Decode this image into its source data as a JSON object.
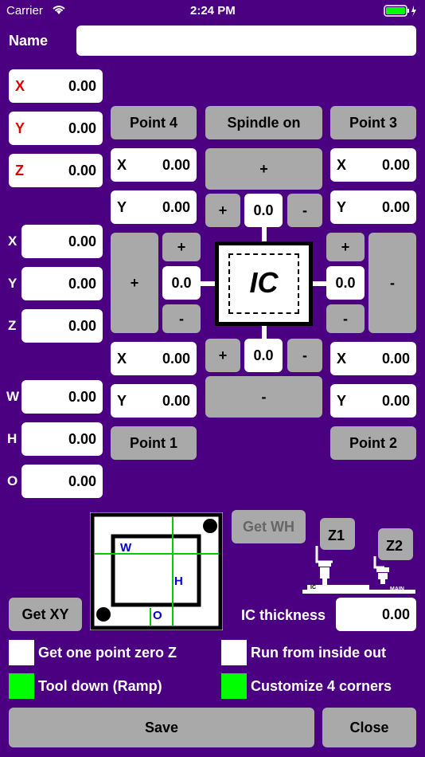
{
  "status": {
    "carrier": "Carrier",
    "time": "2:24 PM"
  },
  "name": {
    "label": "Name",
    "value": ""
  },
  "machine": [
    {
      "axis": "X",
      "value": "0.00"
    },
    {
      "axis": "Y",
      "value": "0.00"
    },
    {
      "axis": "Z",
      "value": "0.00"
    }
  ],
  "offset": [
    {
      "axis": "X",
      "value": "0.00"
    },
    {
      "axis": "Y",
      "value": "0.00"
    },
    {
      "axis": "Z",
      "value": "0.00"
    }
  ],
  "size": [
    {
      "axis": "W",
      "value": "0.00"
    },
    {
      "axis": "H",
      "value": "0.00"
    },
    {
      "axis": "O",
      "value": "0.00"
    }
  ],
  "points": {
    "p4": {
      "label": "Point 4",
      "x": "0.00",
      "y": "0.00"
    },
    "p3": {
      "label": "Point 3",
      "x": "0.00",
      "y": "0.00"
    },
    "p1": {
      "label": "Point 1",
      "x": "0.00",
      "y": "0.00"
    },
    "p2": {
      "label": "Point 2",
      "x": "0.00",
      "y": "0.00"
    },
    "x_label": "X",
    "y_label": "Y"
  },
  "spindle": "Spindle on",
  "jog": {
    "plus": "+",
    "minus": "-",
    "top": "0.0",
    "left": "0.0",
    "right": "0.0",
    "bottom": "0.0"
  },
  "ic_label": "IC",
  "diagram": {
    "w": "W",
    "h": "H",
    "o": "O"
  },
  "get_wh": "Get WH",
  "get_xy": "Get XY",
  "machine_fig": {
    "z1": "Z1",
    "z2": "Z2",
    "ic": "IC",
    "main": "MAIN"
  },
  "ic_thickness": {
    "label": "IC thickness",
    "value": "0.00"
  },
  "options": [
    {
      "label": "Get one point zero Z",
      "checked": false
    },
    {
      "label": "Run from inside out",
      "checked": false
    },
    {
      "label": "Tool down (Ramp)",
      "checked": true
    },
    {
      "label": "Customize 4 corners",
      "checked": true
    }
  ],
  "save": "Save",
  "close": "Close",
  "colors": {
    "background": "#4B0082",
    "button": "#A9A9A9",
    "checked": "#00FF00",
    "axis_red": "#E00000"
  }
}
